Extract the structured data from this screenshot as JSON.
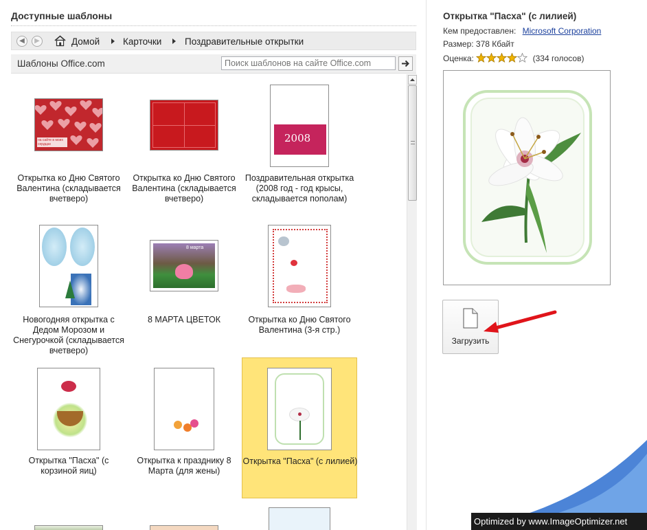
{
  "left": {
    "section_title": "Доступные шаблоны",
    "breadcrumb": [
      "Домой",
      "Карточки",
      "Поздравительные открытки"
    ],
    "source_label": "Шаблоны Office.com",
    "search_placeholder": "Поиск шаблонов на сайте Office.com",
    "tiles": [
      {
        "caption": "Открытка ко Дню Святого Валентина (складывается вчетверо)",
        "thumb_text": "на сайте в моих сердцах"
      },
      {
        "caption": "Открытка ко Дню Святого Валентина (складывается вчетверо)"
      },
      {
        "caption": "Поздравительная открытка (2008 год - год крысы, складывается пополам)",
        "thumb_text": "2008"
      },
      {
        "caption": "Новогодняя открытка с Дедом Морозом и Снегурочкой (складывается вчетверо)"
      },
      {
        "caption": "8 МАРТА ЦВЕТОК",
        "thumb_text": "8 марта"
      },
      {
        "caption": "Открытка ко Дню Святого Валентина (3-я стр.)"
      },
      {
        "caption": "Открытка \"Пасха\" (с корзиной яиц)"
      },
      {
        "caption": "Открытка к празднику 8 Марта (для жены)"
      },
      {
        "caption": "Открытка \"Пасха\" (с лилией)",
        "selected": true
      }
    ]
  },
  "details": {
    "title": "Открытка \"Пасха\" (с лилией)",
    "provider_label": "Кем предоставлен:",
    "provider": "Microsoft Corporation",
    "size": "Размер: 378 Кбайт",
    "rating_label": "Оценка:",
    "rating_stars": 4,
    "rating_max": 5,
    "votes": "(334 голосов)",
    "download_label": "Загрузить"
  },
  "watermark": "Optimized by www.ImageOptimizer.net",
  "colors": {
    "selection": "#ffe479",
    "link": "#1a3f9c",
    "arrow": "#e0141a",
    "star": "#f0b400"
  }
}
